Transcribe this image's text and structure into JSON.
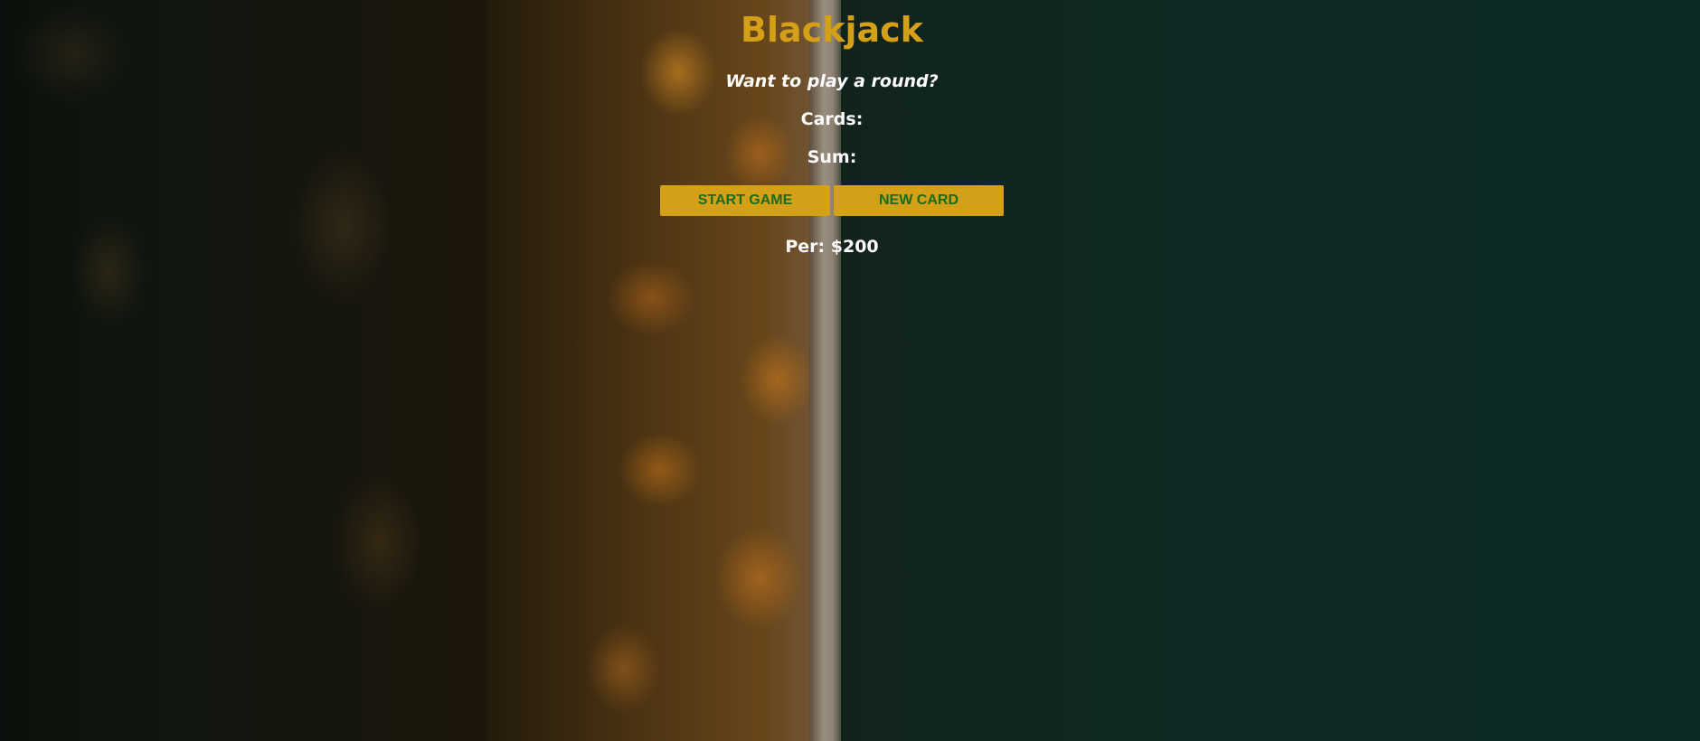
{
  "header": {
    "title": "Blackjack"
  },
  "game": {
    "message": "Want to play a round?",
    "cards_label": "Cards:",
    "sum_label": "Sum:"
  },
  "controls": {
    "start_label": "START GAME",
    "new_card_label": "NEW CARD"
  },
  "player": {
    "info": "Per: $200"
  },
  "colors": {
    "title": "#d4a017",
    "button_bg": "#d4a017",
    "button_text": "#1a6b1a",
    "text": "#ffffff"
  }
}
